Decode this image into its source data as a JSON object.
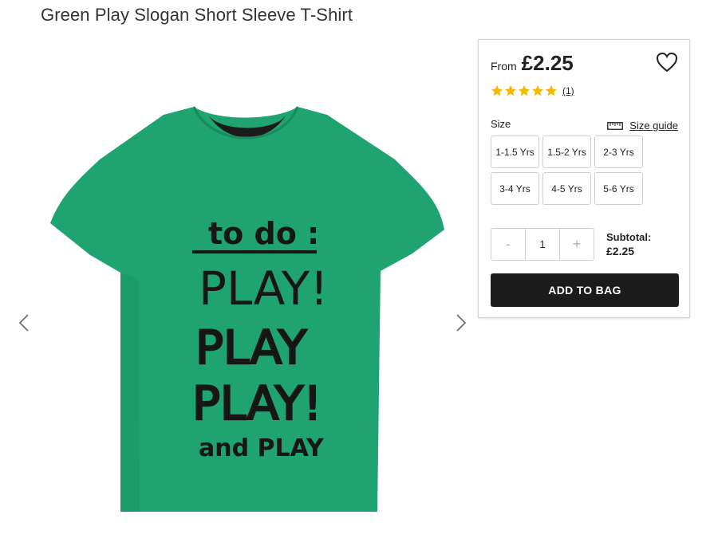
{
  "product": {
    "title": "Green Play Slogan Short Sleeve T-Shirt",
    "image_text": [
      "to do :",
      "PLAY!",
      "PLAY",
      "PLAY!",
      "and PLAY"
    ]
  },
  "gallery": {
    "prev_icon": "chevron-left-icon",
    "next_icon": "chevron-right-icon"
  },
  "purchase": {
    "from_label": "From",
    "price": "£2.25",
    "wishlist_icon": "heart-icon",
    "rating": {
      "stars": 5,
      "review_count": "(1)"
    },
    "size_label": "Size",
    "size_guide_label": "Size guide",
    "size_guide_icon": "ruler-icon",
    "sizes": [
      "1-1.5 Yrs",
      "1.5-2 Yrs",
      "2-3 Yrs",
      "3-4 Yrs",
      "4-5 Yrs",
      "5-6 Yrs"
    ],
    "quantity": {
      "minus": "-",
      "value": "1",
      "plus": "+"
    },
    "subtotal_label": "Subtotal:",
    "subtotal_value": "£2.25",
    "add_to_bag_label": "ADD TO BAG"
  },
  "colors": {
    "shirt": "#1fa371",
    "star": "#f5b800",
    "button": "#1c1c1c"
  }
}
